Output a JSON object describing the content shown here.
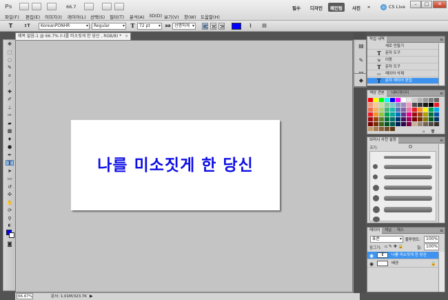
{
  "app": {
    "logo": "Ps",
    "zoom": "66.7",
    "menu": [
      "파일(F)",
      "편집(E)",
      "이미지(I)",
      "레이어(L)",
      "선택(S)",
      "필터(T)",
      "분석(A)",
      "3D(D)",
      "보기(V)",
      "창(W)",
      "도움말(H)"
    ],
    "workspaces": [
      "필수",
      "디자인",
      "페인팅",
      "사진"
    ],
    "active_workspace": "페인팅",
    "more": "»",
    "cs_live": "CS Live",
    "window_controls": {
      "minimize": "–",
      "maximize": "□",
      "close": "✕"
    }
  },
  "options": {
    "tool_icon": "T",
    "orient_icon": "↕T",
    "font_family": "KoreanPONHR",
    "font_style": "Regular",
    "size_icon": "T",
    "font_size": "72 pt",
    "aa_icon": "aa",
    "antialias": "선명하게",
    "text_color": "#0000ff",
    "warp_icon": "⌇"
  },
  "document": {
    "tab_title": "제목 없음-1 @ 66.7% (나를 미소짓게 한 당신 , RGB/8) *",
    "tab_close": "×",
    "canvas_text": "나를 미소짓게 한 당신",
    "text_color": "#0d0de6"
  },
  "status": {
    "zoom": "66.67%",
    "doc_info": "문서: 1.01M/323.7K"
  },
  "panels": {
    "history": {
      "tabs": [
        "작업 내역"
      ],
      "rows": [
        {
          "label": "새로 만들기",
          "icon": ""
        },
        {
          "label": "문자 도구",
          "icon": "T"
        },
        {
          "label": "이동",
          "icon": "⇲"
        },
        {
          "label": "문자 도구",
          "icon": "T"
        },
        {
          "label": "레이어 삭제",
          "icon": "▭"
        },
        {
          "label": "문자 레이어 편집",
          "icon": "T"
        }
      ]
    },
    "swatches": {
      "tabs": [
        "색상 견본",
        "내비게이터"
      ]
    },
    "brushes": {
      "tabs": [
        "브러시 사전 설정"
      ],
      "size_label": "크기:"
    },
    "layers": {
      "tabs": [
        "레이어",
        "채널",
        "패스"
      ],
      "blend_mode": "표준",
      "opacity_label": "불투명도:",
      "opacity": "100%",
      "lock_label": "잠그기:",
      "fill_label": "칠:",
      "fill": "100%",
      "rows": [
        {
          "name": "나를 미소짓게 한 당신",
          "thumb": "T"
        },
        {
          "name": "배경",
          "thumb": ""
        }
      ]
    }
  }
}
